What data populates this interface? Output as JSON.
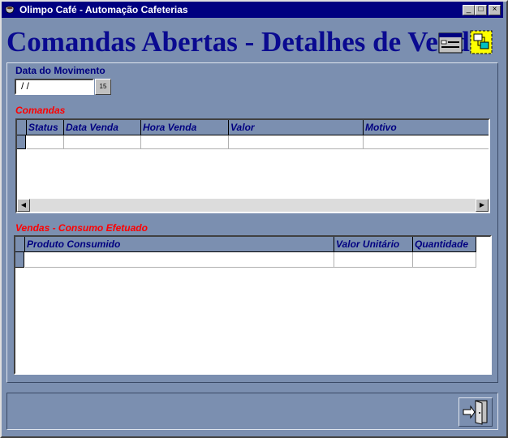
{
  "window": {
    "title": "Olimpo Café - Automação Cafeterias",
    "controls": {
      "minimize": "_",
      "maximize": "□",
      "close": "×"
    }
  },
  "header": {
    "title": "Comandas Abertas - Detalhes de Vendas",
    "icons": [
      "form-window-icon",
      "network-icon"
    ]
  },
  "filter": {
    "date_label": "Data do Movimento",
    "date_value": " /  /",
    "calendar_button": "15"
  },
  "comandas": {
    "title": "Comandas",
    "columns": [
      "Status",
      "Data Venda",
      "Hora Venda",
      "Valor",
      "Motivo"
    ],
    "rows": [
      [
        "",
        "",
        "",
        "",
        ""
      ]
    ]
  },
  "vendas": {
    "title": "Vendas - Consumo Efetuado",
    "columns": [
      "Produto Consumido",
      "Valor Unitário",
      "Quantidade"
    ],
    "rows": [
      [
        "",
        "",
        ""
      ]
    ]
  },
  "footer": {
    "exit_icon": "exit-door-icon"
  },
  "colors": {
    "background": "#7b8fb0",
    "title_bar": "#000080",
    "heading": "#0a0a90",
    "section_title": "#ff0000"
  }
}
